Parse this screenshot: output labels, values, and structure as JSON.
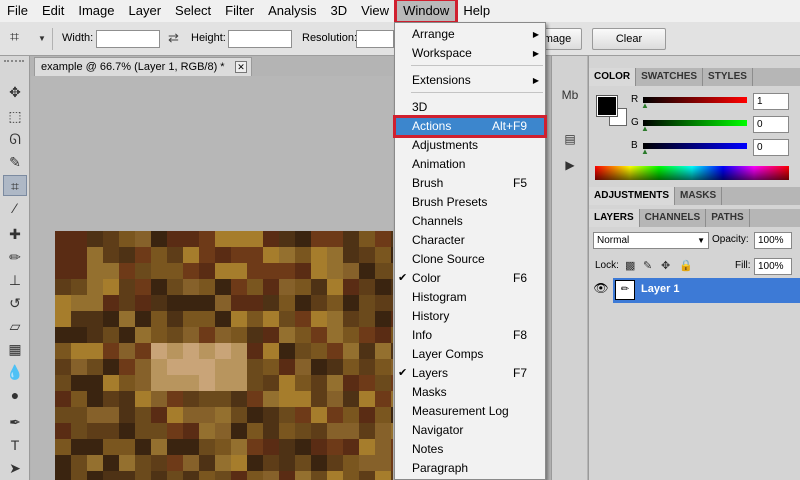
{
  "menubar": {
    "items": [
      "File",
      "Edit",
      "Image",
      "Layer",
      "Select",
      "Filter",
      "Analysis",
      "3D",
      "View",
      "Window",
      "Help"
    ],
    "active": "Window"
  },
  "options": {
    "width_label": "Width:",
    "height_label": "Height:",
    "resolution_label": "Resolution:",
    "front_image_label": "Image",
    "clear_label": "Clear",
    "crop_icon": "crop-icon",
    "swap_icon": "swap-arrows-icon"
  },
  "document": {
    "tab_title": "example @ 66.7% (Layer 1, RGB/8) *",
    "close_glyph": "✕"
  },
  "window_menu": {
    "items": [
      {
        "label": "Arrange",
        "submenu": true
      },
      {
        "label": "Workspace",
        "submenu": true
      },
      {
        "label": "Extensions",
        "submenu": true
      },
      {
        "label": "3D"
      },
      {
        "label": "Actions",
        "shortcut": "Alt+F9",
        "highlighted": true
      },
      {
        "label": "Adjustments"
      },
      {
        "label": "Animation"
      },
      {
        "label": "Brush",
        "shortcut": "F5"
      },
      {
        "label": "Brush Presets"
      },
      {
        "label": "Channels"
      },
      {
        "label": "Character"
      },
      {
        "label": "Clone Source"
      },
      {
        "label": "Color",
        "shortcut": "F6",
        "checked": true
      },
      {
        "label": "Histogram"
      },
      {
        "label": "History"
      },
      {
        "label": "Info",
        "shortcut": "F8"
      },
      {
        "label": "Layer Comps"
      },
      {
        "label": "Layers",
        "shortcut": "F7",
        "checked": true
      },
      {
        "label": "Masks"
      },
      {
        "label": "Measurement Log"
      },
      {
        "label": "Navigator"
      },
      {
        "label": "Notes"
      },
      {
        "label": "Paragraph"
      }
    ]
  },
  "color_panel": {
    "tabs": [
      "COLOR",
      "SWATCHES",
      "STYLES"
    ],
    "channels": [
      {
        "label": "R",
        "value": "1"
      },
      {
        "label": "G",
        "value": "0"
      },
      {
        "label": "B",
        "value": "0"
      }
    ],
    "colors": {
      "foreground": "#000000",
      "background": "#ffffff"
    }
  },
  "adjust_panel": {
    "tabs": [
      "ADJUSTMENTS",
      "MASKS"
    ]
  },
  "layers_panel": {
    "tabs": [
      "LAYERS",
      "CHANNELS",
      "PATHS"
    ],
    "blend_mode": "Normal",
    "opacity_label": "Opacity:",
    "opacity_value": "100%",
    "lock_label": "Lock:",
    "fill_label": "Fill:",
    "fill_value": "100%",
    "layer_name": "Layer 1"
  },
  "accent": {
    "selection": "#3c86cd",
    "highlight_box": "#d0202f"
  }
}
